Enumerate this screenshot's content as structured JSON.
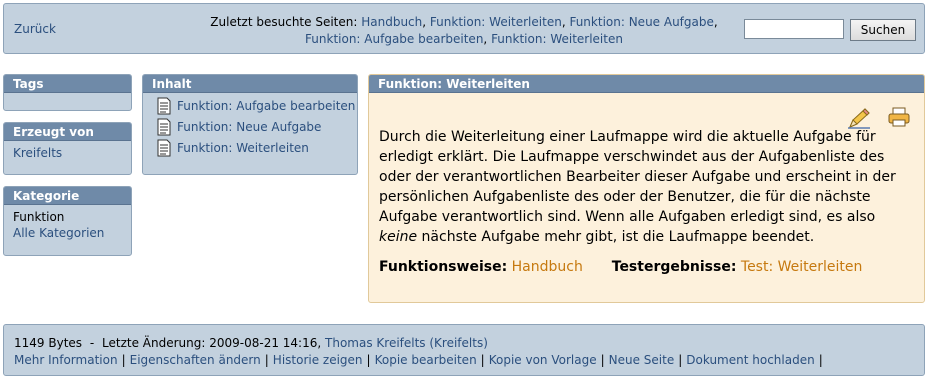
{
  "topbar": {
    "back_label": "Zurück",
    "recent_label": "Zuletzt besuchte Seiten:",
    "recent_pages": [
      "Handbuch",
      "Funktion: Weiterleiten",
      "Funktion: Neue Aufgabe",
      "Funktion: Aufgabe bearbeiten",
      "Funktion: Weiterleiten"
    ],
    "search_value": "",
    "search_button": "Suchen"
  },
  "sidebar": {
    "tags_title": "Tags",
    "created_title": "Erzeugt von",
    "created_by": "Kreifelts",
    "category_title": "Kategorie",
    "category_value": "Funktion",
    "category_all": "Alle Kategorien"
  },
  "contents": {
    "title": "Inhalt",
    "items": [
      "Funktion: Aufgabe bearbeiten",
      "Funktion: Neue Aufgabe",
      "Funktion: Weiterleiten"
    ]
  },
  "article": {
    "title": "Funktion: Weiterleiten",
    "text_before_italic": "Durch die Weiterleitung einer Laufmappe wird die aktuelle Aufgabe für erledigt erklärt. Die Laufmappe verschwindet aus der Aufgabenliste des oder der verantwortlichen Bearbeiter dieser Aufgabe und erscheint in der persönlichen Aufgabenliste des oder der Benutzer, die für die nächste Aufgabe verantwortlich sind. Wenn alle Aufgaben erledigt sind, es also ",
    "text_italic": "keine",
    "text_after_italic": " nächste Aufgabe mehr gibt, ist die Laufmappe beendet.",
    "functionality_label": "Funktionsweise:",
    "functionality_link": "Handbuch",
    "results_label": "Testergebnisse:",
    "results_link": "Test: Weiterleiten",
    "icons": [
      "edit-pencil-icon",
      "print-icon"
    ]
  },
  "footer": {
    "size": "1149 Bytes",
    "dash": "-",
    "changed_label": "Letzte Änderung: 2009-08-21 14:16,",
    "author": "Thomas Kreifelts (Kreifelts)",
    "links": [
      "Mehr Information",
      "Eigenschaften ändern",
      "Historie zeigen",
      "Kopie bearbeiten",
      "Kopie von Vorlage",
      "Neue Seite",
      "Dokument hochladen"
    ]
  },
  "colors": {
    "panel": "#c3d1de",
    "header": "#6f8aa8",
    "link": "#2b4f7e",
    "article_bg": "#fdf1dc",
    "orange_link": "#c6790f"
  }
}
